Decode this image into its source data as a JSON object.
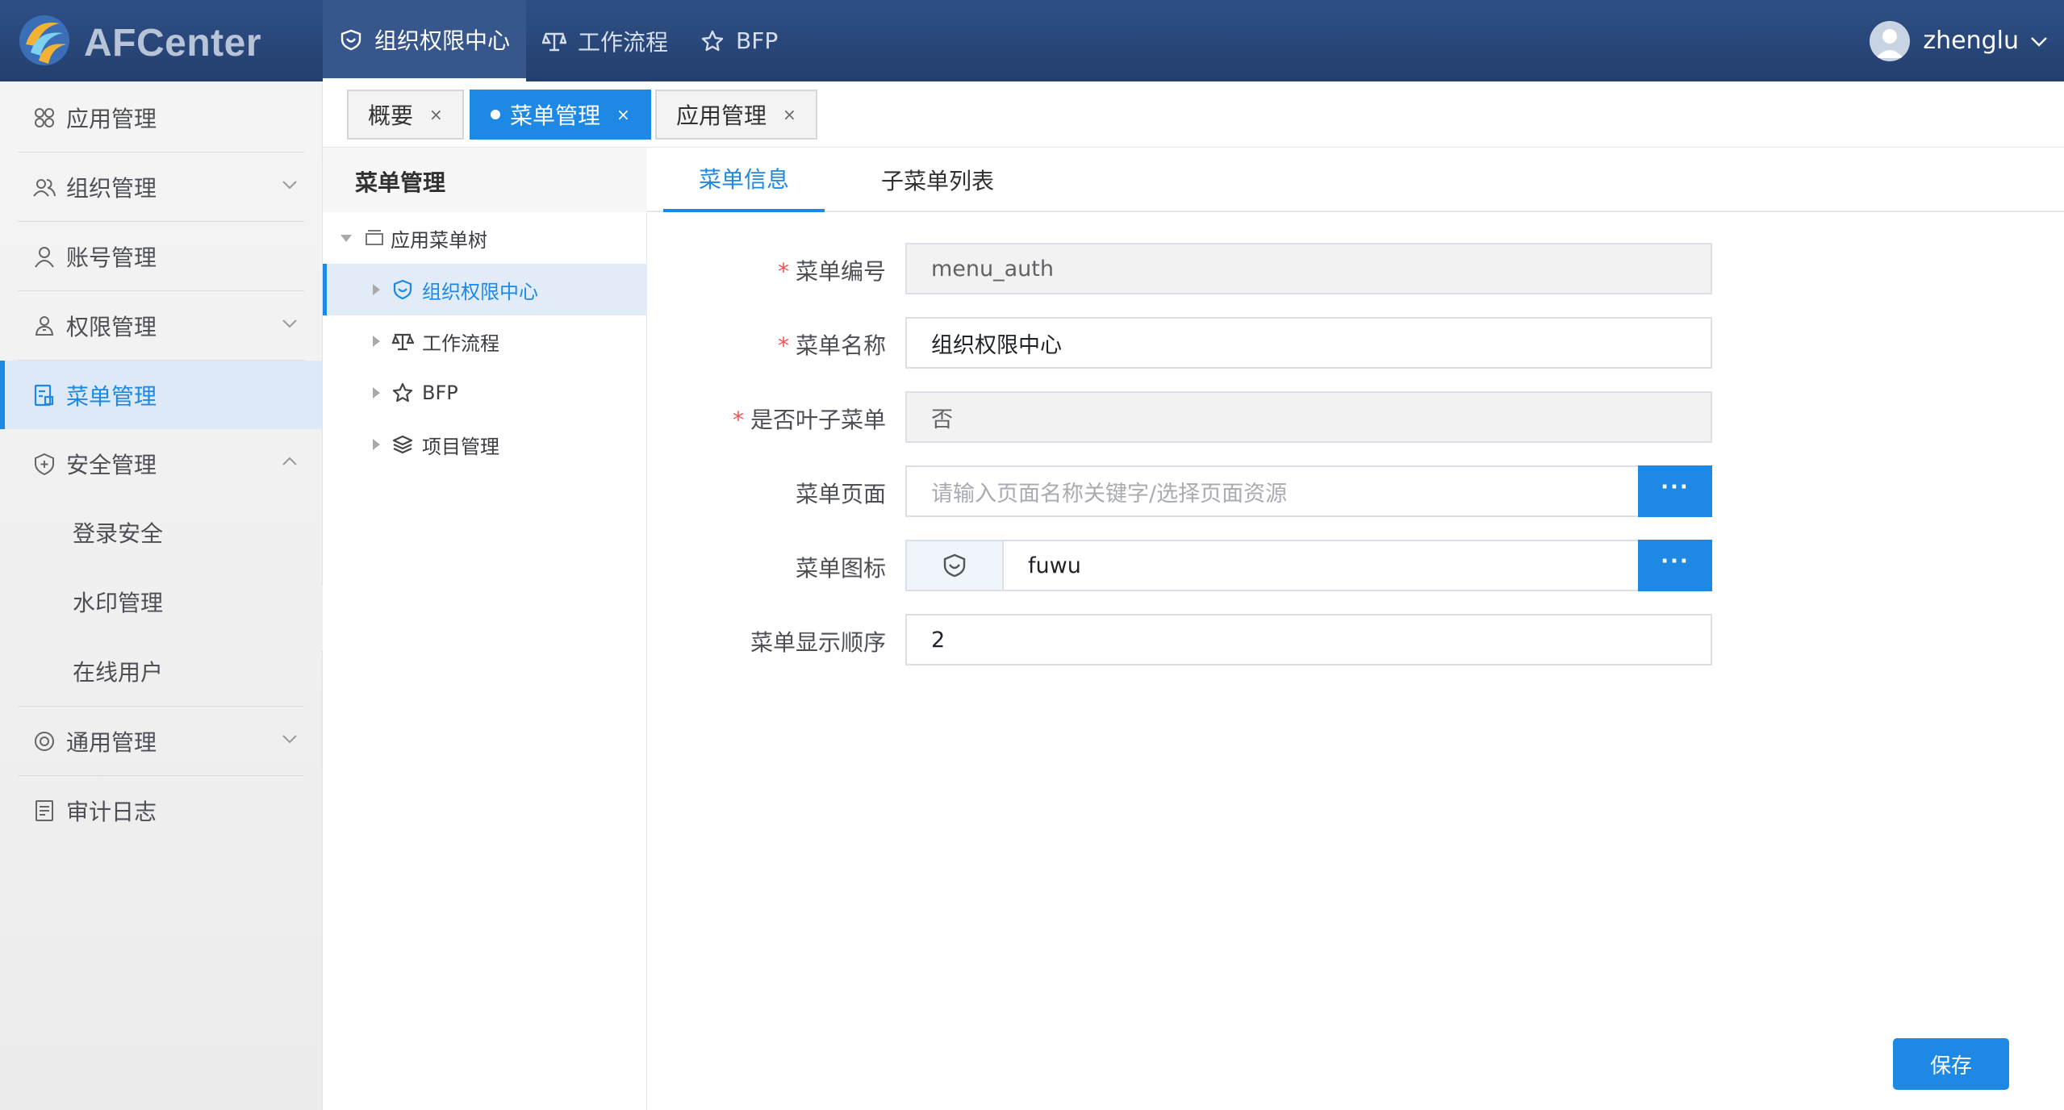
{
  "app": {
    "title": "AFCenter"
  },
  "topnav": [
    {
      "label": "组织权限中心",
      "icon": "heart-shield-icon",
      "active": true
    },
    {
      "label": "工作流程",
      "icon": "balance-scale-icon",
      "active": false
    },
    {
      "label": "BFP",
      "icon": "star-icon",
      "active": false
    }
  ],
  "user": {
    "name": "zhenglu"
  },
  "sidebar": {
    "items": [
      {
        "label": "应用管理",
        "icon": "apps-grid-icon"
      },
      {
        "label": "组织管理",
        "icon": "users-icon"
      },
      {
        "label": "账号管理",
        "icon": "user-icon"
      },
      {
        "label": "权限管理",
        "icon": "permission-user-icon"
      },
      {
        "label": "菜单管理",
        "icon": "menu-doc-icon"
      },
      {
        "label": "安全管理",
        "icon": "shield-plus-icon"
      },
      {
        "label": "通用管理",
        "icon": "settings-icon"
      },
      {
        "label": "审计日志",
        "icon": "log-doc-icon"
      }
    ],
    "security_sub": [
      "登录安全",
      "水印管理",
      "在线用户"
    ]
  },
  "page_tabs": [
    {
      "label": "概要",
      "close": "×"
    },
    {
      "label": "菜单管理",
      "close": "×",
      "active": true
    },
    {
      "label": "应用管理",
      "close": "×"
    }
  ],
  "tree": {
    "title": "菜单管理",
    "root": "应用菜单树",
    "nodes": [
      {
        "label": "组织权限中心",
        "icon": "heart-shield-icon",
        "selected": true
      },
      {
        "label": "工作流程",
        "icon": "balance-scale-icon"
      },
      {
        "label": "BFP",
        "icon": "star-icon"
      },
      {
        "label": "项目管理",
        "icon": "layers-icon"
      }
    ]
  },
  "content_tabs": [
    {
      "label": "菜单信息",
      "active": true
    },
    {
      "label": "子菜单列表"
    }
  ],
  "form": {
    "menu_code": {
      "label": "菜单编号",
      "value": "menu_auth"
    },
    "menu_name": {
      "label": "菜单名称",
      "value": "组织权限中心"
    },
    "is_leaf": {
      "label": "是否叶子菜单",
      "value": "否"
    },
    "menu_page": {
      "label": "菜单页面",
      "placeholder": "请输入页面名称关键字/选择页面资源"
    },
    "menu_icon": {
      "label": "菜单图标",
      "value": "fuwu"
    },
    "menu_order": {
      "label": "菜单显示顺序",
      "value": "2"
    },
    "required_mark": "*",
    "more_label": "···"
  },
  "save_label": "保存",
  "colors": {
    "primary": "#1e88e5",
    "header": "#2a4a7f"
  }
}
